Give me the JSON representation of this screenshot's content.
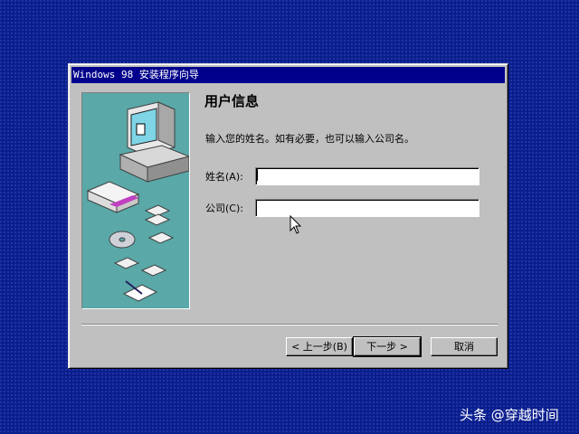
{
  "window": {
    "title": "Windows 98 安装程序向导"
  },
  "page": {
    "heading": "用户信息",
    "description": "输入您的姓名。如有必要，也可以输入公司名。"
  },
  "form": {
    "name_label": "姓名(A):",
    "name_value": "",
    "company_label": "公司(C):",
    "company_value": ""
  },
  "buttons": {
    "back": "< 上一步(B)",
    "next": "下一步 >",
    "cancel": "取消"
  },
  "watermark": "头条 @穿越时间",
  "colors": {
    "desktop": "#0a1e8c",
    "titlebar": "#00008c",
    "panel": "#5aa8a8",
    "face": "#c0c0c0"
  }
}
